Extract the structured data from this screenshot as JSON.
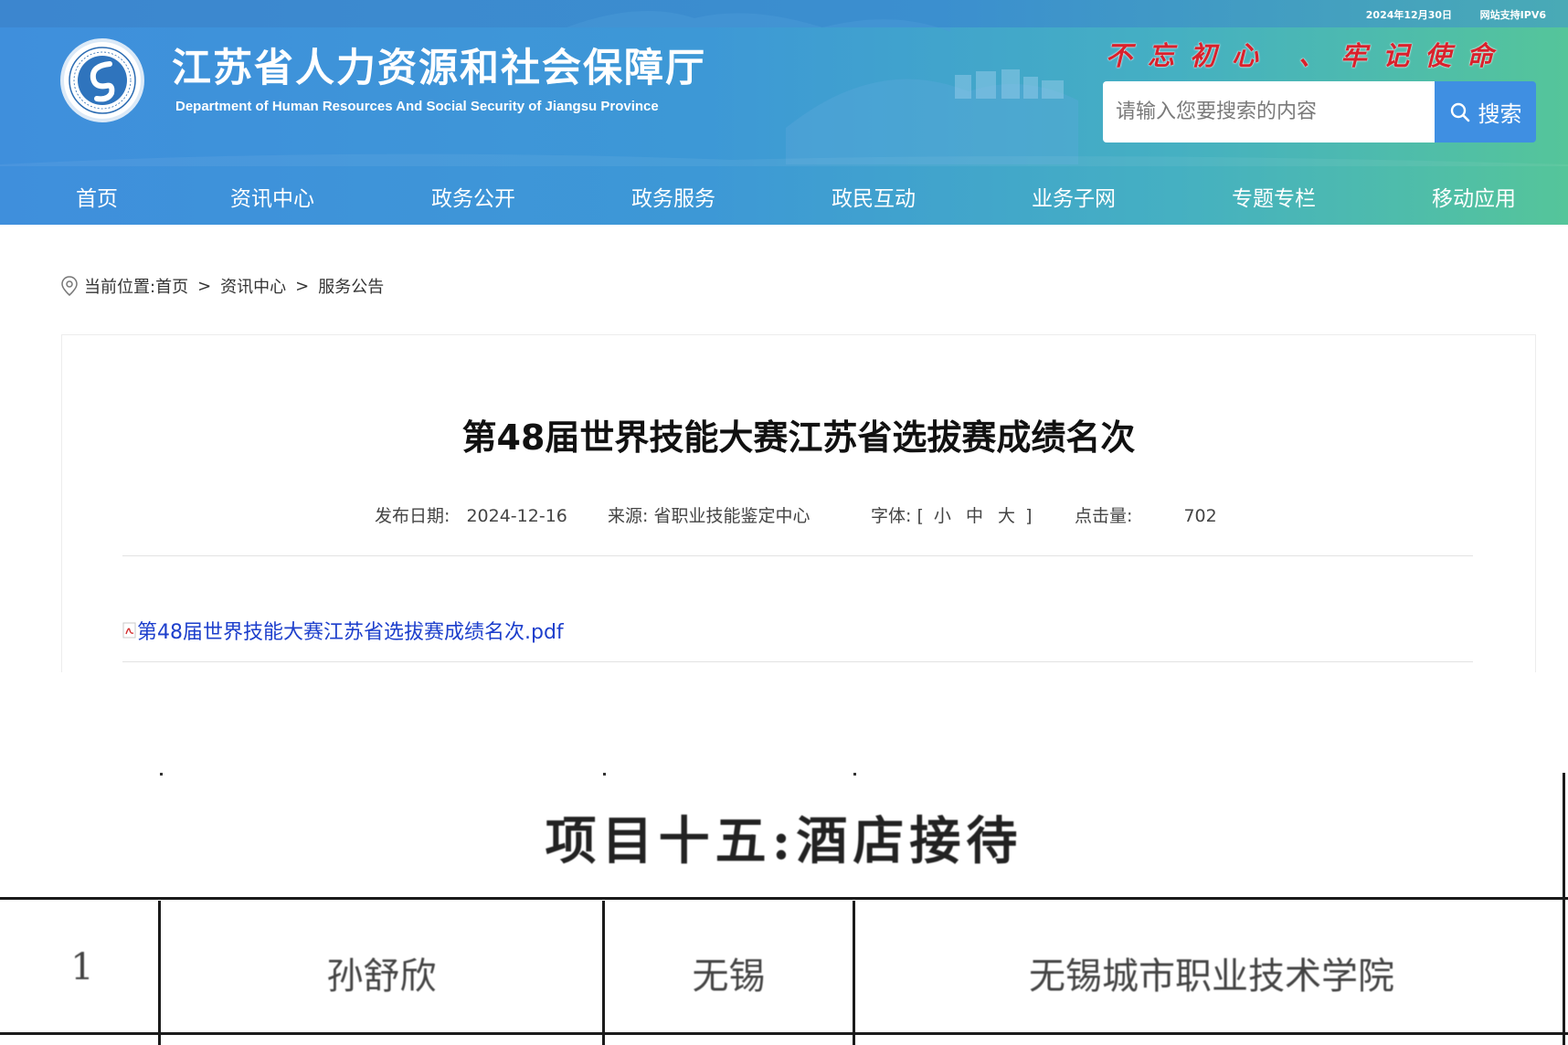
{
  "header": {
    "date": "2024年12月30日",
    "ipv6": "网站支持IPV6",
    "title": "江苏省人力资源和社会保障厅",
    "subtitle": "Department of Human Resources And Social Security of Jiangsu Province",
    "slogan": "不忘初心 、牢记使命",
    "search_placeholder": "请输入您要搜索的内容",
    "search_label": "搜索",
    "logo_icon": "provincial-emblem-icon"
  },
  "nav": {
    "items": [
      "首页",
      "资讯中心",
      "政务公开",
      "政务服务",
      "政民互动",
      "业务子网",
      "专题专栏",
      "移动应用"
    ]
  },
  "breadcrumb": {
    "prefix": "当前位置:",
    "items": [
      "首页",
      "资讯中心",
      "服务公告"
    ],
    "separator": ">"
  },
  "article": {
    "title": "第48届世界技能大赛江苏省选拔赛成绩名次",
    "date_label": "发布日期:",
    "date": "2024-12-16",
    "source_label": "来源:",
    "source": "省职业技能鉴定中心",
    "font_label": "字体:",
    "font_open": "[",
    "font_small": "小",
    "font_medium": "中",
    "font_large": "大",
    "font_close": "]",
    "clicks_label": "点击量:",
    "clicks": "702",
    "attachment": "第48届世界技能大赛江苏省选拔赛成绩名次.pdf"
  },
  "pdf": {
    "heading": "项目十五:酒店接待",
    "row": {
      "rank": "1",
      "name": "孙舒欣",
      "city": "无锡",
      "school": "无锡城市职业技术学院"
    }
  },
  "colors": {
    "header_start": "#3f8fdc",
    "header_end": "#55c59a",
    "slogan": "#d9212c",
    "search_button": "#3f8fe2",
    "link": "#1d3fcc"
  }
}
